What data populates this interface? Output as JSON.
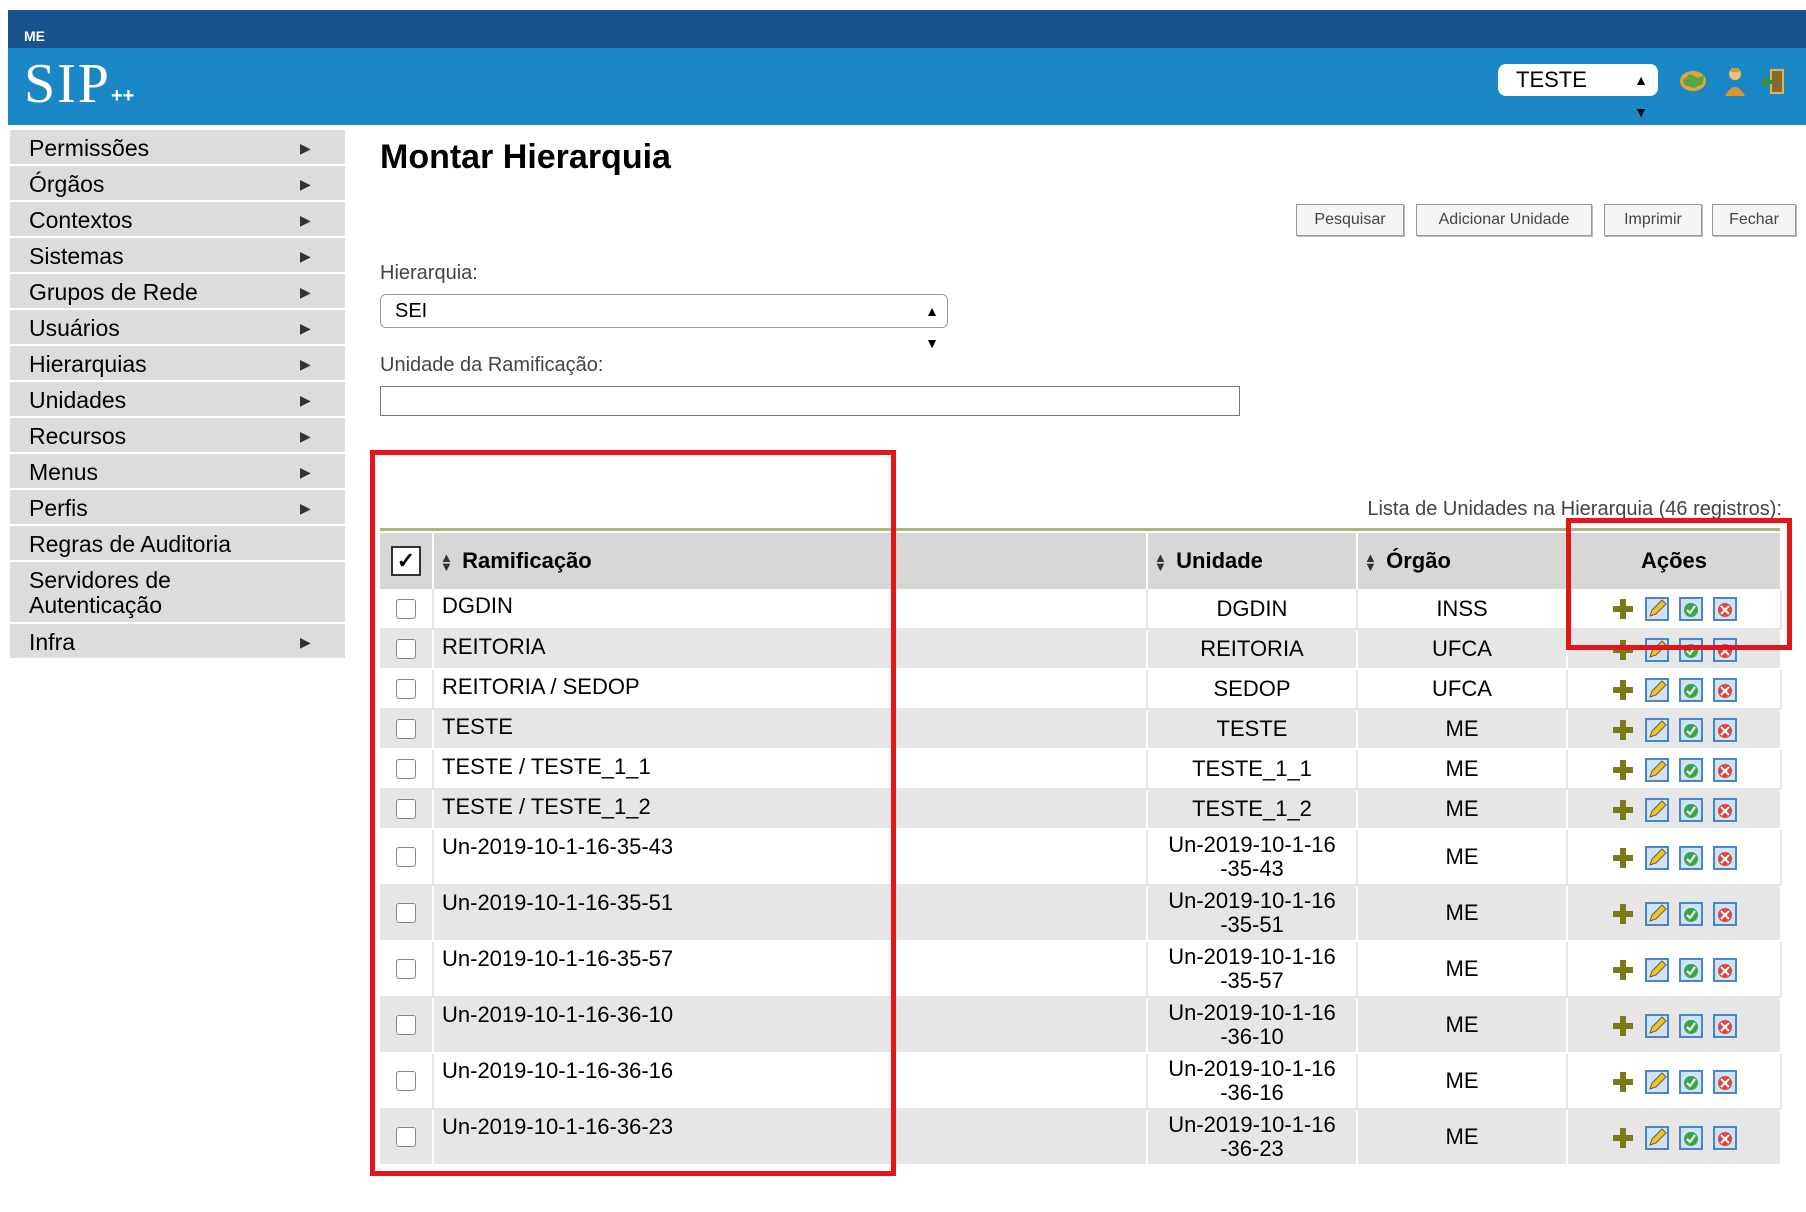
{
  "header": {
    "org": "ME",
    "logo": "SIP",
    "logo_suffix": "++",
    "unit_selected": "TESTE",
    "icons": [
      "map-icon",
      "user-icon",
      "exit-icon"
    ]
  },
  "sidebar": {
    "items": [
      {
        "label": "Permissões",
        "has_sub": true
      },
      {
        "label": "Órgãos",
        "has_sub": true
      },
      {
        "label": "Contextos",
        "has_sub": true
      },
      {
        "label": "Sistemas",
        "has_sub": true
      },
      {
        "label": "Grupos de Rede",
        "has_sub": true
      },
      {
        "label": "Usuários",
        "has_sub": true
      },
      {
        "label": "Hierarquias",
        "has_sub": true
      },
      {
        "label": "Unidades",
        "has_sub": true
      },
      {
        "label": "Recursos",
        "has_sub": true
      },
      {
        "label": "Menus",
        "has_sub": true
      },
      {
        "label": "Perfis",
        "has_sub": true
      },
      {
        "label": "Regras de Auditoria",
        "has_sub": false
      },
      {
        "label": "Servidores de Autenticação",
        "has_sub": false
      },
      {
        "label": "Infra",
        "has_sub": true
      }
    ]
  },
  "main": {
    "title": "Montar Hierarquia",
    "buttons": {
      "search": "Pesquisar",
      "add_unit": "Adicionar Unidade",
      "print": "Imprimir",
      "close": "Fechar"
    },
    "hierarchy_label": "Hierarquia:",
    "hierarchy_value": "SEI",
    "branch_unit_label": "Unidade da Ramificação:",
    "branch_unit_value": ""
  },
  "table": {
    "caption": "Lista de Unidades na Hierarquia (46 registros):",
    "columns": {
      "ramificacao": "Ramificação",
      "unidade": "Unidade",
      "orgao": "Órgão",
      "acoes": "Ações"
    },
    "rows": [
      {
        "ramificacao": "DGDIN",
        "unidade": "DGDIN",
        "orgao": "INSS"
      },
      {
        "ramificacao": "REITORIA",
        "unidade": "REITORIA",
        "orgao": "UFCA"
      },
      {
        "ramificacao": "REITORIA / SEDOP",
        "unidade": "SEDOP",
        "orgao": "UFCA"
      },
      {
        "ramificacao": "TESTE",
        "unidade": "TESTE",
        "orgao": "ME"
      },
      {
        "ramificacao": "TESTE / TESTE_1_1",
        "unidade": "TESTE_1_1",
        "orgao": "ME"
      },
      {
        "ramificacao": "TESTE / TESTE_1_2",
        "unidade": "TESTE_1_2",
        "orgao": "ME"
      },
      {
        "ramificacao": "Un-2019-10-1-16-35-43",
        "unidade": "Un-2019-10-1-16-35-43",
        "orgao": "ME"
      },
      {
        "ramificacao": "Un-2019-10-1-16-35-51",
        "unidade": "Un-2019-10-1-16-35-51",
        "orgao": "ME"
      },
      {
        "ramificacao": "Un-2019-10-1-16-35-57",
        "unidade": "Un-2019-10-1-16-35-57",
        "orgao": "ME"
      },
      {
        "ramificacao": "Un-2019-10-1-16-36-10",
        "unidade": "Un-2019-10-1-16-36-10",
        "orgao": "ME"
      },
      {
        "ramificacao": "Un-2019-10-1-16-36-16",
        "unidade": "Un-2019-10-1-16-36-16",
        "orgao": "ME"
      },
      {
        "ramificacao": "Un-2019-10-1-16-36-23",
        "unidade": "Un-2019-10-1-16-36-23",
        "orgao": "ME"
      }
    ],
    "row_actions": [
      "add-icon",
      "edit-icon",
      "activate-icon",
      "deactivate-icon"
    ]
  },
  "colors": {
    "header_top": "#18538f",
    "header": "#1a88c6",
    "sidebar_item": "#dcdcdc",
    "highlight_box": "#e3141a"
  }
}
